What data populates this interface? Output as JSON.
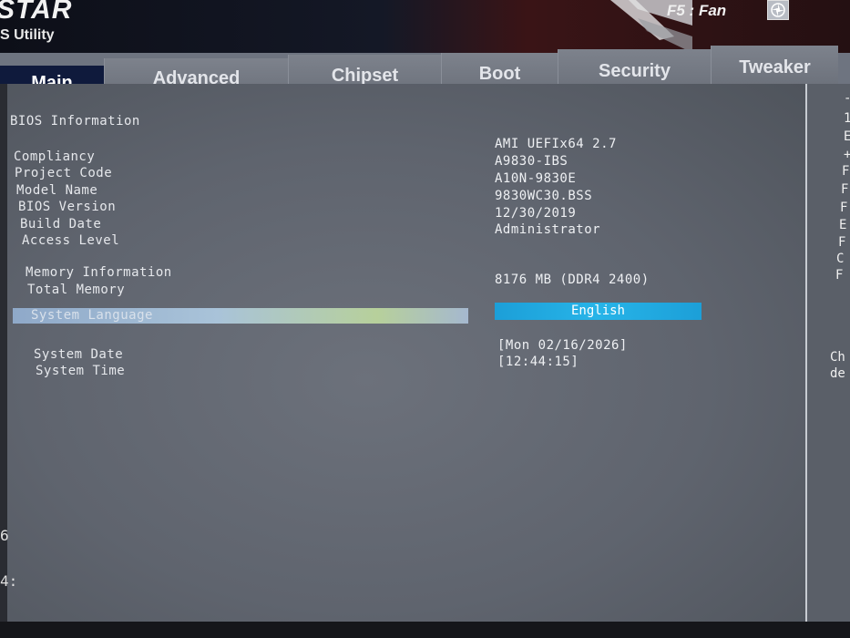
{
  "header": {
    "brand": "STAR",
    "brand_sub": "S Utility",
    "fan_label": "F5 : Fan",
    "fan_icon": "fan-icon"
  },
  "tabs": [
    {
      "label": "Main",
      "active": true
    },
    {
      "label": "Advanced",
      "active": false
    },
    {
      "label": "Chipset",
      "active": false
    },
    {
      "label": "Boot",
      "active": false
    },
    {
      "label": "Security",
      "active": false
    },
    {
      "label": "Tweaker",
      "active": false
    }
  ],
  "main": {
    "section_title": "BIOS Information",
    "rows": [
      {
        "label": "Compliancy",
        "value": "AMI UEFIx64 2.7"
      },
      {
        "label": "Project Code",
        "value": "A9830-IBS"
      },
      {
        "label": "Model Name",
        "value": "A10N-9830E"
      },
      {
        "label": "BIOS Version",
        "value": "9830WC30.BSS"
      },
      {
        "label": "Build Date",
        "value": "12/30/2019"
      },
      {
        "label": "Access Level",
        "value": "Administrator"
      }
    ],
    "memory_title": "Memory Information",
    "total_memory_label": "Total Memory",
    "total_memory_value": "8176 MB (DDR4 2400)",
    "language_label": "System Language",
    "language_value": "English",
    "date_label": "System Date",
    "date_value": "[Mon 02/16/2026]",
    "time_label": "System Time",
    "time_value": "[12:44:15]"
  },
  "right_panel": {
    "chars": [
      "-",
      "1",
      "E",
      "+",
      "F",
      "F",
      "F",
      "E",
      "F",
      "C",
      "F"
    ],
    "help_lines": [
      "Ch",
      "de"
    ]
  },
  "left_edge": {
    "chars": [
      "6",
      "4:"
    ]
  },
  "colors": {
    "tab_active_bg": "#0f1a3c",
    "highlight_value": "#1c9fd8",
    "panel_bg": "#646a74"
  }
}
